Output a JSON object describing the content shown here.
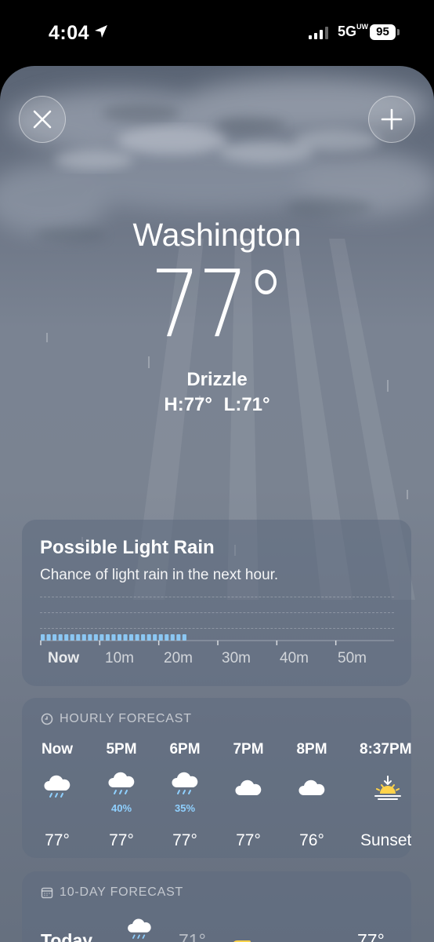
{
  "status": {
    "time": "4:04",
    "network": "5G",
    "network_badge": "UW",
    "battery": "95"
  },
  "weather": {
    "city": "Washington",
    "temperature": "77°",
    "condition": "Drizzle",
    "high_low": "H:77°  L:71°"
  },
  "buttons": {
    "close_icon": "close-icon",
    "add_icon": "plus-icon"
  },
  "rain_card": {
    "title": "Possible Light Rain",
    "subtitle": "Chance of light rain in the next hour.",
    "minute_labels": [
      "Now",
      "10m",
      "20m",
      "30m",
      "40m",
      "50m"
    ],
    "rain_minutes": 25
  },
  "hourly": {
    "header": "HOURLY FORECAST",
    "hours": [
      {
        "time": "Now",
        "icon": "rain-cloud-icon",
        "pop": "",
        "temp": "77°"
      },
      {
        "time": "5PM",
        "icon": "rain-cloud-icon",
        "pop": "40%",
        "temp": "77°"
      },
      {
        "time": "6PM",
        "icon": "rain-cloud-icon",
        "pop": "35%",
        "temp": "77°"
      },
      {
        "time": "7PM",
        "icon": "cloud-icon",
        "pop": "",
        "temp": "77°"
      },
      {
        "time": "8PM",
        "icon": "cloud-icon",
        "pop": "",
        "temp": "76°"
      },
      {
        "time": "8:37PM",
        "icon": "sunset-icon",
        "pop": "",
        "temp": "Sunset"
      }
    ]
  },
  "ten_day": {
    "header": "10-DAY FORECAST",
    "first_row": {
      "day": "Today",
      "low": "71°",
      "high": "77°"
    }
  },
  "colors": {
    "precip": "#8fd0ff",
    "sun": "#ffd34a"
  }
}
